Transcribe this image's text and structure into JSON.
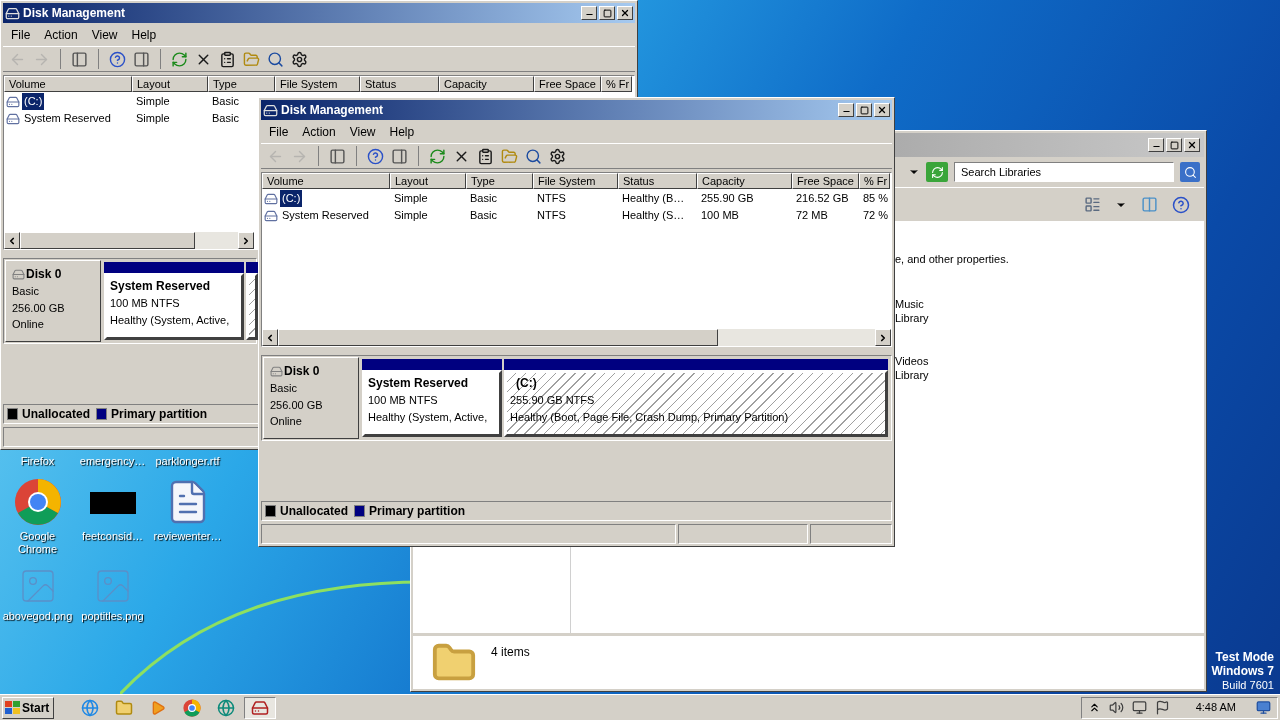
{
  "desktop": {
    "icons": [
      {
        "label": "Firefox",
        "kind": "hidden"
      },
      {
        "label": "emergency…",
        "kind": "hidden"
      },
      {
        "label": "parklonger.rtf",
        "kind": "hidden"
      },
      {
        "label": "Google Chrome",
        "kind": "chrome"
      },
      {
        "label": "feetconsid…",
        "kind": "thumbnail"
      },
      {
        "label": "reviewenter…",
        "kind": "document"
      },
      {
        "label": "abovegod.png",
        "kind": "image"
      },
      {
        "label": "poptitles.png",
        "kind": "image"
      }
    ],
    "notice": [
      "Test Mode",
      "Windows 7",
      "Build 7601"
    ]
  },
  "windows": [
    {
      "kind": "disk-management",
      "title": "Disk Management",
      "menu": [
        "File",
        "Action",
        "View",
        "Help"
      ],
      "toolbar": [
        {
          "kind": "back",
          "disabled": true
        },
        {
          "kind": "forward",
          "disabled": true
        },
        {
          "kind": "console-tree",
          "disabled": false
        },
        {
          "kind": "help",
          "disabled": false
        },
        {
          "kind": "action-pane",
          "disabled": false
        },
        {
          "kind": "refresh",
          "disabled": false
        },
        {
          "kind": "delete",
          "disabled": false
        },
        {
          "kind": "properties",
          "disabled": false
        },
        {
          "kind": "open",
          "disabled": false
        },
        {
          "kind": "search",
          "disabled": false
        },
        {
          "kind": "settings",
          "disabled": false
        }
      ],
      "columns": [
        "Volume",
        "Layout",
        "Type",
        "File System",
        "Status",
        "Capacity",
        "Free Space",
        "% Fr"
      ],
      "rows": [
        {
          "selected": true,
          "cells": [
            "(C:)",
            "Simple",
            "Basic"
          ]
        },
        {
          "selected": false,
          "cells": [
            "System Reserved",
            "Simple",
            "Basic"
          ]
        }
      ],
      "disk": {
        "name": "Disk 0",
        "type": "Basic",
        "size": "256.00 GB",
        "status": "Online"
      },
      "partitions": [
        {
          "selected": false,
          "name": "System Reserved",
          "size": "100 MB NTFS",
          "status": "Healthy (System, Active,"
        },
        {
          "selected": true
        }
      ],
      "legend": [
        {
          "label": "Unallocated",
          "color": "#000000"
        },
        {
          "label": "Primary partition",
          "color": "#000080"
        }
      ]
    },
    {
      "kind": "explorer",
      "search": {
        "placeholder": "Search Libraries"
      },
      "description": "e, and other properties.",
      "libraries": [
        {
          "name": "Music",
          "type": "Library"
        },
        {
          "name": "Videos",
          "type": "Library"
        }
      ],
      "status": "4 items"
    },
    {
      "kind": "disk-management",
      "title": "Disk Management",
      "menu": [
        "File",
        "Action",
        "View",
        "Help"
      ],
      "toolbar": [
        {
          "kind": "back",
          "disabled": true
        },
        {
          "kind": "forward",
          "disabled": true
        },
        {
          "kind": "console-tree",
          "disabled": false
        },
        {
          "kind": "help",
          "disabled": false
        },
        {
          "kind": "action-pane",
          "disabled": false
        },
        {
          "kind": "refresh",
          "disabled": false
        },
        {
          "kind": "delete",
          "disabled": false
        },
        {
          "kind": "properties",
          "disabled": false
        },
        {
          "kind": "open",
          "disabled": false
        },
        {
          "kind": "search",
          "disabled": false
        },
        {
          "kind": "settings",
          "disabled": false
        }
      ],
      "columns": [
        "Volume",
        "Layout",
        "Type",
        "File System",
        "Status",
        "Capacity",
        "Free Space",
        "% Fr"
      ],
      "rows": [
        {
          "selected": true,
          "cells": [
            "(C:)",
            "Simple",
            "Basic",
            "NTFS",
            "Healthy (B…",
            "255.90 GB",
            "216.52 GB",
            "85 %"
          ]
        },
        {
          "selected": false,
          "cells": [
            "System Reserved",
            "Simple",
            "Basic",
            "NTFS",
            "Healthy (S…",
            "100 MB",
            "72 MB",
            "72 %"
          ]
        }
      ],
      "disk": {
        "name": "Disk 0",
        "type": "Basic",
        "size": "256.00 GB",
        "status": "Online"
      },
      "partitions": [
        {
          "selected": false,
          "name": "System Reserved",
          "size": "100 MB NTFS",
          "status": "Healthy (System, Active,"
        },
        {
          "selected": true,
          "name": "(C:)",
          "size": "255.90 GB NTFS",
          "status": "Healthy (Boot, Page File, Crash Dump, Primary Partition)"
        }
      ],
      "legend": [
        {
          "label": "Unallocated",
          "color": "#000000"
        },
        {
          "label": "Primary partition",
          "color": "#000080"
        }
      ]
    }
  ],
  "taskbar": {
    "start": "Start",
    "items": [
      {
        "kind": "browser",
        "selected": false
      },
      {
        "kind": "folder",
        "selected": false
      },
      {
        "kind": "media",
        "selected": false
      },
      {
        "kind": "chrome",
        "selected": false
      },
      {
        "kind": "edge",
        "selected": false
      },
      {
        "kind": "disk-management",
        "selected": true
      }
    ],
    "time": "4:48 AM"
  }
}
